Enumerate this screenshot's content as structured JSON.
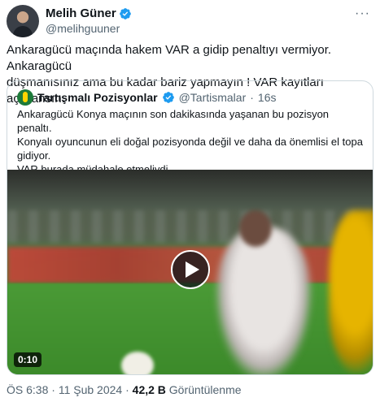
{
  "author": {
    "name": "Melih Güner",
    "handle": "@melihguuner",
    "more_label": "···"
  },
  "tweet": {
    "line1": "Ankaragücü maçında hakem VAR a gidip penaltıyı vermiyor. Ankaragücü",
    "line2": "düşmanısınız ama bu kadar bariz yapmayın !  VAR kayıtları açıklansın."
  },
  "quote": {
    "name": "Tartışmalı Pozisyonlar",
    "handle": "@Tartismalar",
    "dot": "·",
    "time": "16s",
    "line1": "Ankaragücü Konya maçının son dakikasında yaşanan bu pozisyon penaltı.",
    "line2": "Konyalı oyuncunun eli doğal pozisyonda değil ve daha da önemlisi el topa",
    "line3": "gidiyor.",
    "line4": "VAR burada müdahale etmeliydi.",
    "video_duration": "0:10"
  },
  "meta": {
    "time": "ÖS 6:38",
    "sep1": " · ",
    "date": "11 Şub 2024",
    "sep2": " · ",
    "views": "42,2 B",
    "views_label": " Görüntülenme"
  },
  "colors": {
    "verified": "#1d9bf0",
    "text": "#0f1419",
    "secondary": "#536471",
    "border": "#cfd9de"
  },
  "icons": {
    "verified": "verified-badge-icon",
    "play": "play-icon",
    "more": "more-icon"
  }
}
